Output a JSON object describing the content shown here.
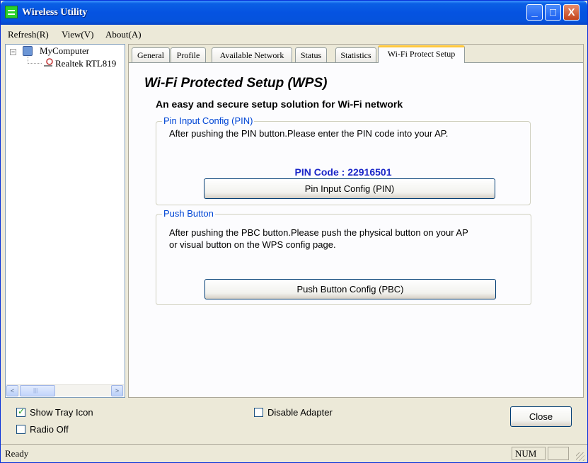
{
  "window": {
    "title": "Wireless Utility",
    "controls": {
      "minimize": "_",
      "maximize": "□",
      "close": "X"
    }
  },
  "menu": [
    "Refresh(R)",
    "View(V)",
    "About(A)"
  ],
  "tree": {
    "root": "MyComputer",
    "expander": "−",
    "child": "Realtek RTL819"
  },
  "scrollbar": {
    "left_arrow": "<",
    "right_arrow": ">",
    "thumb_grip": "|||"
  },
  "tabs": [
    "General",
    "Profile",
    "Available Network",
    "Status",
    "Statistics",
    "Wi-Fi Protect Setup"
  ],
  "active_tab": "Wi-Fi Protect Setup",
  "wps": {
    "title": "Wi-Fi Protected Setup (WPS)",
    "subtitle": "An easy and secure setup solution for Wi-Fi network",
    "pin_group": {
      "legend": "Pin Input Config (PIN)",
      "description": "After pushing the PIN button.Please enter the PIN code into your AP.",
      "pin_code_label": "PIN Code :",
      "pin_code_value": "22916501",
      "button": "Pin Input Config (PIN)"
    },
    "pbc_group": {
      "legend": "Push Button",
      "description_line1": "After pushing the PBC button.Please push the physical button on your AP",
      "description_line2": "or visual button on the WPS config page.",
      "button": "Push Button Config (PBC)"
    }
  },
  "options": {
    "show_tray_icon": {
      "label": "Show Tray Icon",
      "checked": true
    },
    "radio_off": {
      "label": "Radio Off",
      "checked": false
    },
    "disable_adapter": {
      "label": "Disable Adapter",
      "checked": false
    }
  },
  "close_button": "Close",
  "status": {
    "text": "Ready",
    "num": "NUM"
  },
  "colors": {
    "title_bar": "#0553e1",
    "legend_text": "#0046d5",
    "pin_code": "#1b27c8",
    "active_tab_accent": "#ffc83c"
  }
}
